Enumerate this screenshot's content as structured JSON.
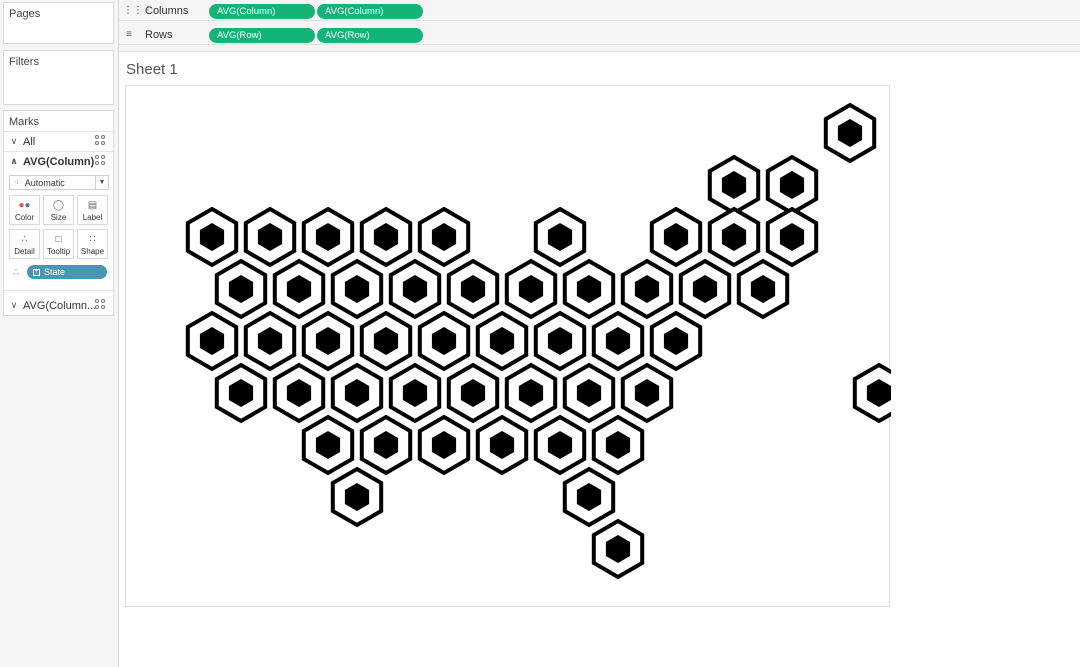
{
  "left_panel": {
    "pages_title": "Pages",
    "filters_title": "Filters",
    "marks_title": "Marks",
    "marks_all": "All",
    "marks_avg_column": "AVG(Column)",
    "mark_type": "Automatic",
    "buttons": [
      "Color",
      "Size",
      "Label",
      "Detail",
      "Tooltip",
      "Shape"
    ],
    "state_pill": "State",
    "marks_avg_column2": "AVG(Column..."
  },
  "shelves": {
    "columns_label": "Columns",
    "rows_label": "Rows",
    "columns_pills": [
      "AVG(Column)",
      "AVG(Column)"
    ],
    "rows_pills": [
      "AVG(Row)",
      "AVG(Row)"
    ]
  },
  "sheet": {
    "title": "Sheet 1"
  },
  "chart_data": {
    "type": "scatter",
    "mark_shape": "hexagon (outer ring + inner filled hexagon, dual axis)",
    "x_field": "AVG(Column)",
    "y_field": "AVG(Row)",
    "detail": "State",
    "points": [
      {
        "col": 11,
        "row": 0
      },
      {
        "col": 9,
        "row": 1
      },
      {
        "col": 10,
        "row": 1
      },
      {
        "col": 0,
        "row": 2
      },
      {
        "col": 1,
        "row": 2
      },
      {
        "col": 2,
        "row": 2
      },
      {
        "col": 3,
        "row": 2
      },
      {
        "col": 4,
        "row": 2
      },
      {
        "col": 6,
        "row": 2
      },
      {
        "col": 8,
        "row": 2
      },
      {
        "col": 9,
        "row": 2
      },
      {
        "col": 10,
        "row": 2
      },
      {
        "col": 0.5,
        "row": 3
      },
      {
        "col": 1.5,
        "row": 3
      },
      {
        "col": 2.5,
        "row": 3
      },
      {
        "col": 3.5,
        "row": 3
      },
      {
        "col": 4.5,
        "row": 3
      },
      {
        "col": 5.5,
        "row": 3
      },
      {
        "col": 6.5,
        "row": 3
      },
      {
        "col": 7.5,
        "row": 3
      },
      {
        "col": 8.5,
        "row": 3
      },
      {
        "col": 9.5,
        "row": 3
      },
      {
        "col": 0,
        "row": 4
      },
      {
        "col": 1,
        "row": 4
      },
      {
        "col": 2,
        "row": 4
      },
      {
        "col": 3,
        "row": 4
      },
      {
        "col": 4,
        "row": 4
      },
      {
        "col": 5,
        "row": 4
      },
      {
        "col": 6,
        "row": 4
      },
      {
        "col": 7,
        "row": 4
      },
      {
        "col": 8,
        "row": 4
      },
      {
        "col": 0.5,
        "row": 5
      },
      {
        "col": 1.5,
        "row": 5
      },
      {
        "col": 2.5,
        "row": 5
      },
      {
        "col": 3.5,
        "row": 5
      },
      {
        "col": 4.5,
        "row": 5
      },
      {
        "col": 5.5,
        "row": 5
      },
      {
        "col": 6.5,
        "row": 5
      },
      {
        "col": 7.5,
        "row": 5
      },
      {
        "col": 11.5,
        "row": 5
      },
      {
        "col": 2,
        "row": 6
      },
      {
        "col": 3,
        "row": 6
      },
      {
        "col": 4,
        "row": 6
      },
      {
        "col": 5,
        "row": 6
      },
      {
        "col": 6,
        "row": 6
      },
      {
        "col": 7,
        "row": 6
      },
      {
        "col": 2.5,
        "row": 7
      },
      {
        "col": 6.5,
        "row": 7
      },
      {
        "col": 7,
        "row": 8
      }
    ],
    "grid": false,
    "axes_visible": false
  },
  "colors": {
    "pill_green": "#14b479",
    "pill_blue": "#4996b2",
    "mark": "#000000"
  }
}
